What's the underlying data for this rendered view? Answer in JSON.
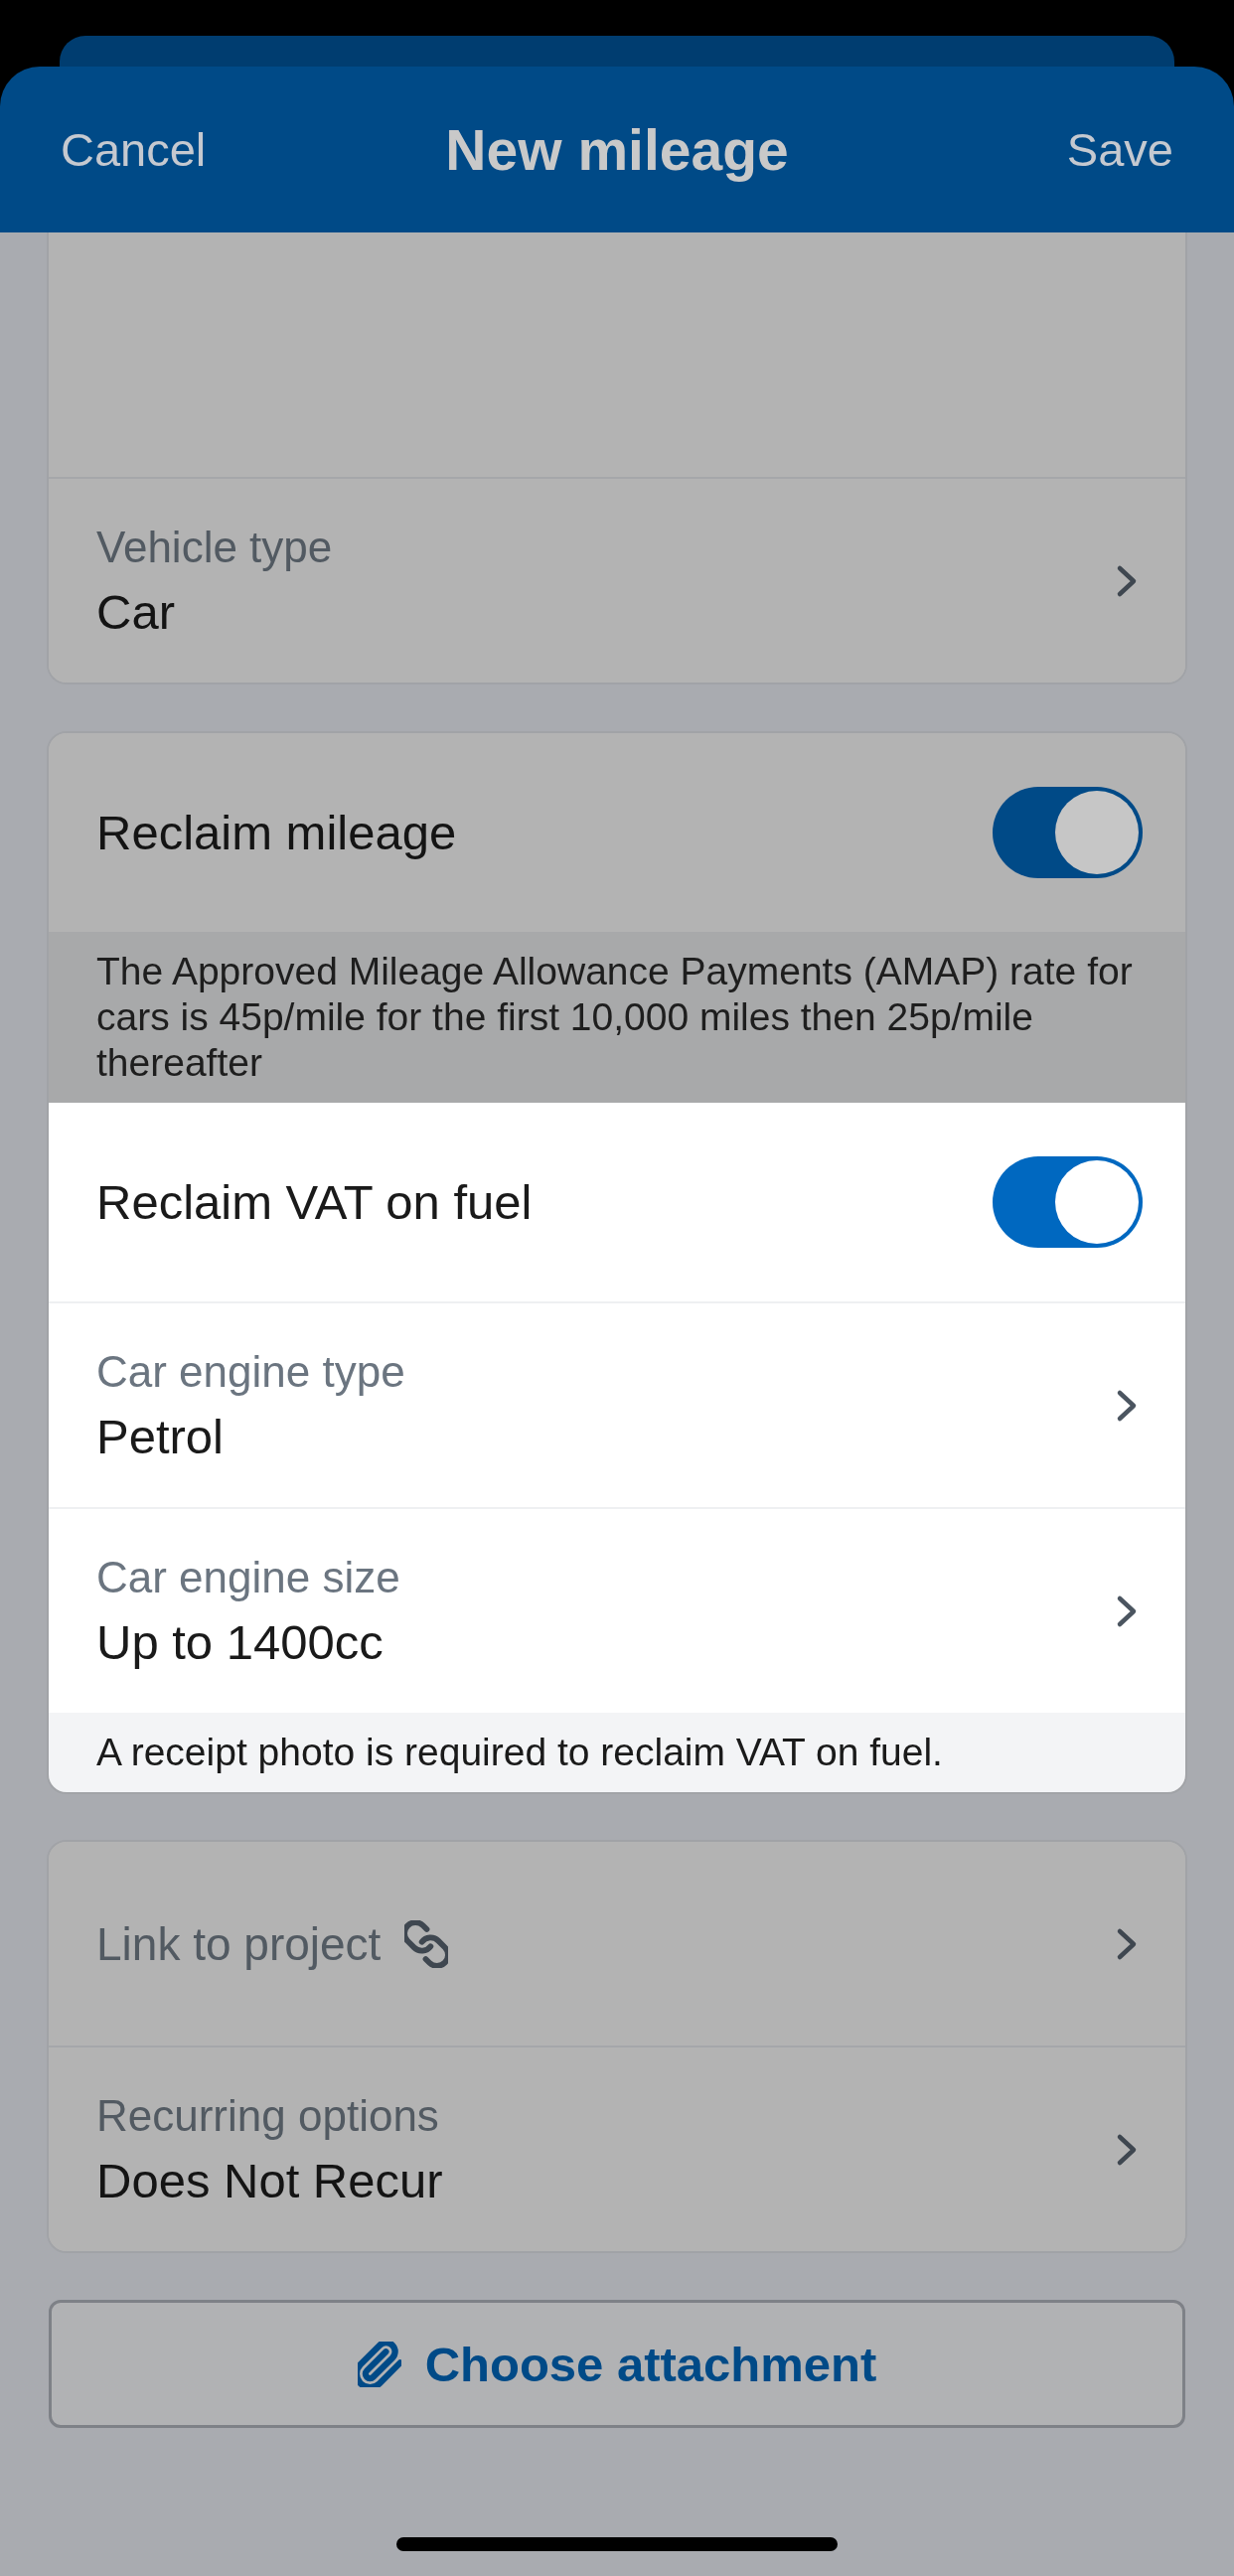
{
  "header": {
    "cancel": "Cancel",
    "title": "New mileage",
    "save": "Save"
  },
  "sections": [
    {
      "items": [
        {
          "kind": "spacer",
          "highlighted": false
        },
        {
          "kind": "picker",
          "label": "Vehicle type",
          "value": "Car",
          "highlighted": false
        }
      ]
    },
    {
      "items": [
        {
          "kind": "toggle",
          "label": "Reclaim mileage",
          "on": true,
          "highlighted": false
        },
        {
          "kind": "note",
          "text": "The Approved Mileage Allowance Payments (AMAP) rate for cars is 45p/mile for the first 10,000 miles then 25p/mile thereafter",
          "highlighted": false
        },
        {
          "kind": "toggle",
          "label": "Reclaim VAT on fuel",
          "on": true,
          "highlighted": true
        },
        {
          "kind": "picker",
          "label": "Car engine type",
          "value": "Petrol",
          "highlighted": true
        },
        {
          "kind": "picker",
          "label": "Car engine size",
          "value": "Up to 1400cc",
          "highlighted": true
        },
        {
          "kind": "note",
          "text": "A receipt photo is required to reclaim VAT on fuel.",
          "highlighted": true
        }
      ]
    },
    {
      "items": [
        {
          "kind": "link",
          "label": "Link to project",
          "highlighted": false
        },
        {
          "kind": "picker",
          "label": "Recurring options",
          "value": "Does Not Recur",
          "highlighted": false
        }
      ]
    }
  ],
  "attachment_button": {
    "label": "Choose attachment"
  }
}
